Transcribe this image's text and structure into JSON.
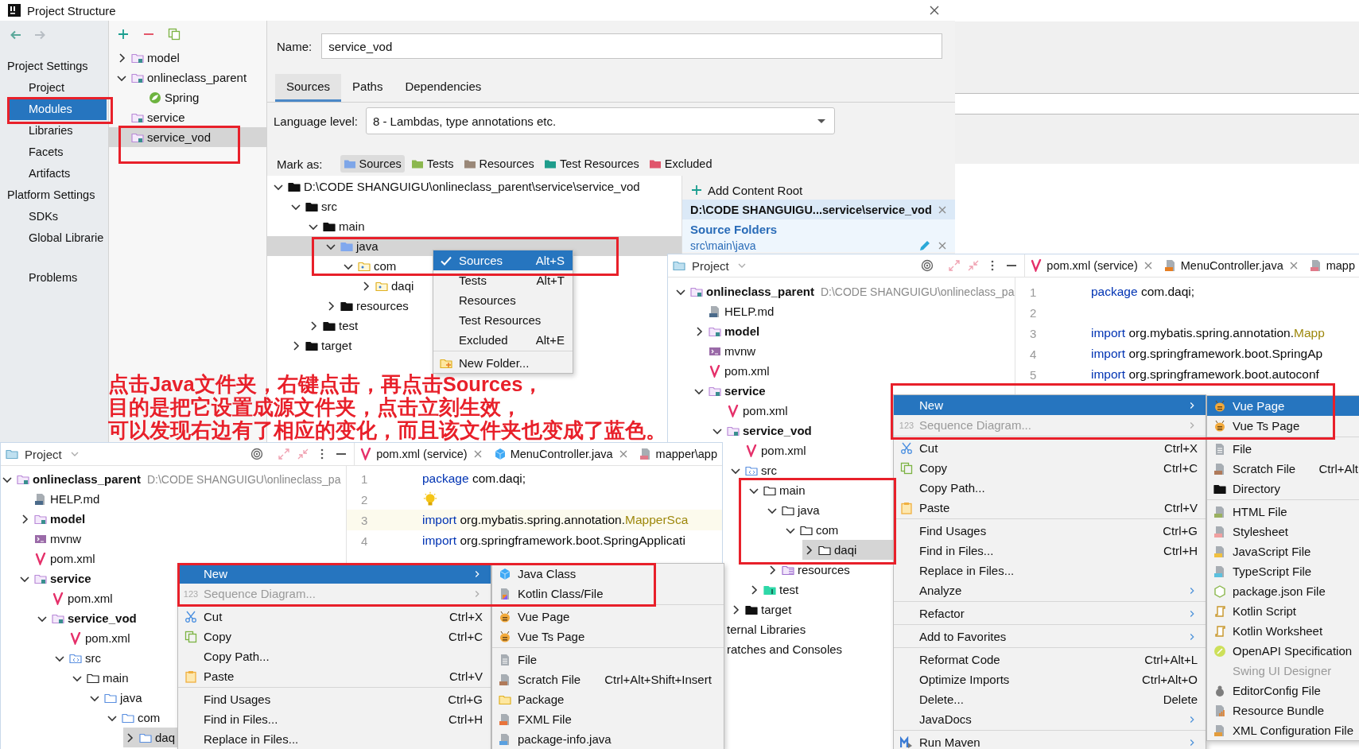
{
  "dialog": {
    "title": "Project Structure",
    "sidebar": [
      {
        "heading": "Project Settings",
        "items": [
          {
            "label": "Project",
            "selected": false
          },
          {
            "label": "Modules",
            "selected": true
          },
          {
            "label": "Libraries",
            "selected": false
          },
          {
            "label": "Facets",
            "selected": false
          },
          {
            "label": "Artifacts",
            "selected": false
          }
        ]
      },
      {
        "heading": "Platform Settings",
        "items": [
          {
            "label": "SDKs",
            "selected": false
          },
          {
            "label": "Global Librarie",
            "selected": false
          }
        ]
      },
      {
        "items": [
          {
            "label": "Problems",
            "selected": false
          }
        ]
      }
    ],
    "modules": [
      {
        "label": "model",
        "kind": "module",
        "expanded": false,
        "selected": false
      },
      {
        "label": "onlineclass_parent",
        "kind": "module",
        "expanded": true,
        "selected": false,
        "children": [
          {
            "label": "Spring",
            "kind": "spring",
            "selected": false
          }
        ]
      },
      {
        "label": "service",
        "kind": "module",
        "selected": false
      },
      {
        "label": "service_vod",
        "kind": "module",
        "selected": true
      }
    ],
    "name_label": "Name:",
    "name_value": "service_vod",
    "tabs": [
      {
        "label": "Sources",
        "selected": true
      },
      {
        "label": "Paths",
        "selected": false
      },
      {
        "label": "Dependencies",
        "selected": false
      }
    ],
    "language_level_label": "Language level:",
    "language_level": "8 - Lambdas, type annotations etc.",
    "mark_as_label": "Mark as:",
    "mark_buttons": [
      {
        "label": "Sources",
        "color": "#7ea6e8",
        "selected": true
      },
      {
        "label": "Tests",
        "color": "#8cb84f",
        "selected": false
      },
      {
        "label": "Resources",
        "color": "#9a8878",
        "selected": false
      },
      {
        "label": "Test Resources",
        "color": "#1f9d8c",
        "selected": false
      },
      {
        "label": "Excluded",
        "color": "#e0566c",
        "selected": false
      }
    ],
    "content_tree": [
      {
        "label": "D:\\CODE SHANGUIGU\\onlineclass_parent\\service\\service_vod",
        "kind": "folder",
        "expanded": true,
        "selected": false,
        "children": [
          {
            "label": "src",
            "kind": "folder",
            "expanded": true,
            "selected": false,
            "children": [
              {
                "label": "main",
                "kind": "folder",
                "expanded": true,
                "selected": false,
                "children": [
                  {
                    "label": "java",
                    "kind": "source",
                    "expanded": true,
                    "selected": true,
                    "children": [
                      {
                        "label": "com",
                        "kind": "pkg",
                        "expanded": true,
                        "selected": false,
                        "children": [
                          {
                            "label": "daqi",
                            "kind": "pkg",
                            "expanded": false,
                            "selected": false
                          }
                        ]
                      }
                    ]
                  },
                  {
                    "label": "resources",
                    "kind": "folder",
                    "expanded": false,
                    "selected": false
                  }
                ]
              },
              {
                "label": "test",
                "kind": "folder",
                "expanded": false,
                "selected": false
              }
            ]
          },
          {
            "label": "target",
            "kind": "folder",
            "expanded": false,
            "selected": false
          }
        ]
      }
    ],
    "content_root": {
      "add_label": "Add Content Root",
      "path": "D:\\CODE SHANGUIGU...service\\service_vod",
      "source_heading": "Source Folders",
      "source_path": "src\\main\\java"
    },
    "context_menu": [
      {
        "label": "Sources",
        "shortcut": "Alt+S",
        "kind": "check",
        "checked": true,
        "selected": true
      },
      {
        "label": "Tests",
        "shortcut": "Alt+T",
        "kind": "check",
        "checked": false,
        "selected": false
      },
      {
        "label": "Resources",
        "kind": "check",
        "checked": false,
        "selected": false
      },
      {
        "label": "Test Resources",
        "kind": "check",
        "checked": false,
        "selected": false
      },
      {
        "label": "Excluded",
        "shortcut": "Alt+E",
        "kind": "check",
        "checked": false,
        "selected": false
      },
      {
        "kind": "separator"
      },
      {
        "label": "New Folder...",
        "kind": "new-folder",
        "selected": false
      }
    ]
  },
  "annotation": [
    "点击Java文件夹，右键点击，再点击Sources，",
    "目的是把它设置成源文件夹，点击立刻生效，",
    "可以发现右边有了相应的变化，而且该文件夹也变成了蓝色。"
  ],
  "project_windows": [
    {
      "title": "Project",
      "tree": [
        {
          "label": "onlineclass_parent",
          "path": "D:\\CODE SHANGUIGU\\onlineclass_pa",
          "kind": "module",
          "expanded": true,
          "selected": false,
          "children": [
            {
              "label": "HELP.md",
              "kind": "md",
              "selected": false
            },
            {
              "label": "model",
              "kind": "module",
              "expanded": false,
              "selected": false
            },
            {
              "label": "mvnw",
              "kind": "mvnw",
              "selected": false
            },
            {
              "label": "pom.xml",
              "kind": "maven",
              "selected": false
            },
            {
              "label": "service",
              "kind": "module",
              "expanded": true,
              "selected": false,
              "children": [
                {
                  "label": "pom.xml",
                  "kind": "maven",
                  "selected": false
                },
                {
                  "label": "service_vod",
                  "kind": "module",
                  "expanded": true,
                  "selected": false,
                  "children": [
                    {
                      "label": "pom.xml",
                      "kind": "maven",
                      "selected": false
                    },
                    {
                      "label": "src",
                      "kind": "src",
                      "expanded": true,
                      "selected": false,
                      "children": [
                        {
                          "label": "main",
                          "kind": "folder-o",
                          "expanded": true,
                          "selected": false,
                          "children": [
                            {
                              "label": "java",
                              "kind": "folder-o",
                              "expanded": true,
                              "selected": false,
                              "children": [
                                {
                                  "label": "com",
                                  "kind": "folder-o",
                                  "expanded": true,
                                  "selected": false,
                                  "children": [
                                    {
                                      "label": "daqi",
                                      "kind": "folder-o",
                                      "expanded": false,
                                      "selected": true
                                    }
                                  ]
                                }
                              ]
                            },
                            {
                              "label": "resources",
                              "kind": "res",
                              "expanded": false,
                              "selected": false
                            }
                          ]
                        },
                        {
                          "label": "test",
                          "kind": "test",
                          "expanded": false,
                          "selected": false
                        }
                      ]
                    },
                    {
                      "label": "target",
                      "kind": "folder",
                      "expanded": false,
                      "selected": false
                    }
                  ]
                }
              ]
            }
          ]
        },
        {
          "label": "ternal Libraries",
          "kind": "partial",
          "selected": false
        },
        {
          "label": "ratches and Consoles",
          "kind": "partial",
          "selected": false
        }
      ],
      "editor_tabs": [
        {
          "label": "pom.xml (service)",
          "kind": "maven",
          "closable": true
        },
        {
          "label": "MenuController.java",
          "kind": "jfile",
          "closable": true
        },
        {
          "label": "mapp",
          "kind": "yml",
          "closable": false
        }
      ],
      "code": [
        {
          "number": "1",
          "tokens": [
            {
              "text": "package",
              "kind": "keyword"
            },
            {
              "text": " com.daqi;",
              "kind": "plain"
            }
          ]
        },
        {
          "number": "2"
        },
        {
          "number": "3",
          "tokens": [
            {
              "text": "import",
              "kind": "keyword"
            },
            {
              "text": " org.mybatis.spring.annotation.",
              "kind": "plain"
            },
            {
              "text": "Mapp",
              "kind": "type"
            }
          ]
        },
        {
          "number": "4",
          "tokens": [
            {
              "text": "import",
              "kind": "keyword"
            },
            {
              "text": " org.springframework.boot.SpringAp",
              "kind": "plain"
            }
          ]
        },
        {
          "number": "5",
          "tokens": [
            {
              "text": "import",
              "kind": "keyword"
            },
            {
              "text": " org.springframework.boot.autoconf",
              "kind": "plain"
            }
          ]
        }
      ],
      "context_menu": [
        {
          "label": "New",
          "kind": "text",
          "arrow": true,
          "selected": true
        },
        {
          "label": "Sequence Diagram...",
          "icon_text": "123",
          "kind": "text",
          "arrow": true,
          "disabled": true,
          "selected": false
        },
        {
          "kind": "separator"
        },
        {
          "label": "Cut",
          "shortcut": "Ctrl+X",
          "kind": "cut",
          "selected": false
        },
        {
          "label": "Copy",
          "shortcut": "Ctrl+C",
          "kind": "copy",
          "selected": false
        },
        {
          "label": "Copy Path...",
          "kind": "text",
          "selected": false
        },
        {
          "label": "Paste",
          "shortcut": "Ctrl+V",
          "kind": "paste",
          "selected": false
        },
        {
          "kind": "separator"
        },
        {
          "label": "Find Usages",
          "shortcut": "Ctrl+G",
          "kind": "text",
          "selected": false
        },
        {
          "label": "Find in Files...",
          "shortcut": "Ctrl+H",
          "kind": "text",
          "selected": false
        },
        {
          "label": "Replace in Files...",
          "kind": "text",
          "selected": false
        },
        {
          "label": "Analyze",
          "kind": "text",
          "arrow": true,
          "selected": false
        },
        {
          "kind": "separator"
        },
        {
          "label": "Refactor",
          "kind": "text",
          "arrow": true,
          "selected": false
        },
        {
          "kind": "separator"
        },
        {
          "label": "Add to Favorites",
          "kind": "text",
          "arrow": true,
          "selected": false
        },
        {
          "kind": "separator"
        },
        {
          "label": "Reformat Code",
          "shortcut": "Ctrl+Alt+L",
          "kind": "text",
          "selected": false
        },
        {
          "label": "Optimize Imports",
          "shortcut": "Ctrl+Alt+O",
          "kind": "text",
          "selected": false
        },
        {
          "label": "Delete...",
          "shortcut": "Delete",
          "kind": "text",
          "selected": false
        },
        {
          "label": "JavaDocs",
          "kind": "text",
          "arrow": true,
          "selected": false
        },
        {
          "kind": "separator"
        },
        {
          "label": "Run Maven",
          "kind": "maven-run",
          "arrow": true,
          "selected": false
        }
      ],
      "submenu": [
        {
          "label": "Vue Page",
          "kind": "vue",
          "selected": true
        },
        {
          "label": "Vue Ts Page",
          "kind": "vue",
          "selected": false
        },
        {
          "kind": "separator"
        },
        {
          "label": "File",
          "kind": "file",
          "selected": false
        },
        {
          "label": "Scratch File",
          "shortcut": "Ctrl+Alt",
          "kind": "scratch",
          "selected": false
        },
        {
          "label": "Directory",
          "kind": "dir",
          "selected": false
        },
        {
          "kind": "separator"
        },
        {
          "label": "HTML File",
          "kind": "html",
          "selected": false
        },
        {
          "label": "Stylesheet",
          "kind": "css",
          "selected": false
        },
        {
          "label": "JavaScript File",
          "kind": "js",
          "selected": false
        },
        {
          "label": "TypeScript File",
          "kind": "ts",
          "selected": false
        },
        {
          "label": "package.json File",
          "kind": "pjson",
          "selected": false
        },
        {
          "label": "Kotlin Script",
          "kind": "kts",
          "selected": false
        },
        {
          "label": "Kotlin Worksheet",
          "kind": "kts",
          "selected": false
        },
        {
          "label": "OpenAPI Specification",
          "kind": "openapi",
          "selected": false
        },
        {
          "label": "Swing UI Designer",
          "kind": "text",
          "disabled": true,
          "selected": false
        },
        {
          "label": "EditorConfig File",
          "kind": "editorconfig",
          "selected": false
        },
        {
          "label": "Resource Bundle",
          "kind": "bundle",
          "selected": false
        },
        {
          "label": "XML Configuration File",
          "kind": "xml",
          "selected": false
        }
      ]
    },
    {
      "title": "Project",
      "tree": [
        {
          "label": "onlineclass_parent",
          "path": "D:\\CODE SHANGUIGU\\onlineclass_pa",
          "kind": "module",
          "expanded": true,
          "selected": false,
          "children": [
            {
              "label": "HELP.md",
              "kind": "md",
              "selected": false
            },
            {
              "label": "model",
              "kind": "module",
              "expanded": false,
              "selected": false
            },
            {
              "label": "mvnw",
              "kind": "mvnw",
              "selected": false
            },
            {
              "label": "pom.xml",
              "kind": "maven",
              "selected": false
            },
            {
              "label": "service",
              "kind": "module",
              "expanded": true,
              "selected": false,
              "children": [
                {
                  "label": "pom.xml",
                  "kind": "maven",
                  "selected": false
                },
                {
                  "label": "service_vod",
                  "kind": "module",
                  "expanded": true,
                  "selected": false,
                  "children": [
                    {
                      "label": "pom.xml",
                      "kind": "maven",
                      "selected": false
                    },
                    {
                      "label": "src",
                      "kind": "src",
                      "expanded": true,
                      "selected": false,
                      "children": [
                        {
                          "label": "main",
                          "kind": "folder-o",
                          "expanded": true,
                          "selected": false,
                          "children": [
                            {
                              "label": "java",
                              "kind": "source-o",
                              "expanded": true,
                              "selected": false,
                              "children": [
                                {
                                  "label": "com",
                                  "kind": "source-o",
                                  "expanded": true,
                                  "selected": false,
                                  "children": [
                                    {
                                      "label": "daq",
                                      "kind": "source-o",
                                      "expanded": false,
                                      "selected": true
                                    }
                                  ]
                                }
                              ]
                            }
                          ]
                        }
                      ]
                    }
                  ]
                }
              ]
            }
          ]
        }
      ],
      "editor_tabs": [
        {
          "label": "pom.xml (service)",
          "kind": "maven",
          "closable": true
        },
        {
          "label": "MenuController.java",
          "kind": "java",
          "closable": true
        },
        {
          "label": "mapper\\app",
          "kind": "yml",
          "closable": false
        }
      ],
      "code": [
        {
          "number": "1",
          "tokens": [
            {
              "text": "package",
              "kind": "keyword"
            },
            {
              "text": " com.daqi;",
              "kind": "plain"
            }
          ]
        },
        {
          "number": "2",
          "kind": "bulb"
        },
        {
          "number": "3",
          "current": true,
          "tokens": [
            {
              "text": "import",
              "kind": "keyword"
            },
            {
              "text": " org.mybatis.spring.annotation.",
              "kind": "plain"
            },
            {
              "text": "MapperSca",
              "kind": "type"
            }
          ]
        },
        {
          "number": "4",
          "tokens": [
            {
              "text": "import",
              "kind": "keyword"
            },
            {
              "text": " org.springframework.boot.SpringApplicati",
              "kind": "plain"
            }
          ]
        }
      ],
      "context_menu": [
        {
          "label": "New",
          "kind": "text",
          "arrow": true,
          "selected": true
        },
        {
          "label": "Sequence Diagram...",
          "icon_text": "123",
          "kind": "text",
          "arrow": true,
          "disabled": true,
          "selected": false
        },
        {
          "kind": "separator"
        },
        {
          "label": "Cut",
          "shortcut": "Ctrl+X",
          "kind": "cut",
          "selected": false
        },
        {
          "label": "Copy",
          "shortcut": "Ctrl+C",
          "kind": "copy",
          "selected": false
        },
        {
          "label": "Copy Path...",
          "kind": "text",
          "selected": false
        },
        {
          "label": "Paste",
          "shortcut": "Ctrl+V",
          "kind": "paste",
          "selected": false
        },
        {
          "kind": "separator"
        },
        {
          "label": "Find Usages",
          "shortcut": "Ctrl+G",
          "kind": "text",
          "selected": false
        },
        {
          "label": "Find in Files...",
          "shortcut": "Ctrl+H",
          "kind": "text",
          "selected": false
        },
        {
          "label": "Replace in Files...",
          "kind": "text",
          "selected": false
        }
      ],
      "submenu": [
        {
          "label": "Java Class",
          "kind": "java",
          "selected": false
        },
        {
          "label": "Kotlin Class/File",
          "kind": "kotlin",
          "selected": false
        },
        {
          "kind": "separator"
        },
        {
          "label": "Vue Page",
          "kind": "vue",
          "selected": false
        },
        {
          "label": "Vue Ts Page",
          "kind": "vue",
          "selected": false
        },
        {
          "kind": "separator"
        },
        {
          "label": "File",
          "kind": "file",
          "selected": false
        },
        {
          "label": "Scratch File",
          "shortcut": "Ctrl+Alt+Shift+Insert",
          "kind": "scratch",
          "selected": false
        },
        {
          "label": "Package",
          "kind": "jpkg",
          "selected": false
        },
        {
          "label": "FXML File",
          "kind": "fxml",
          "selected": false
        },
        {
          "label": "package-info.java",
          "kind": "pinfo",
          "selected": false
        }
      ]
    }
  ]
}
